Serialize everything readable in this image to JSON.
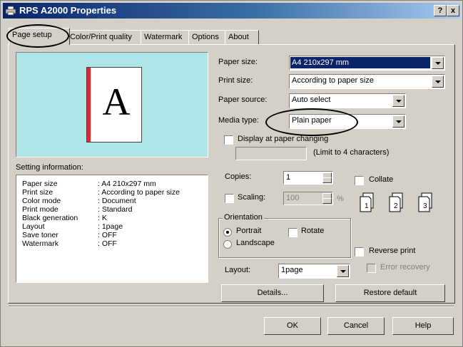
{
  "window": {
    "title": "RPS A2000 Properties",
    "help_button": "?",
    "close_button": "x"
  },
  "tabs": [
    {
      "label": "Page setup"
    },
    {
      "label": "Color/Print quality"
    },
    {
      "label": "Watermark"
    },
    {
      "label": "Options"
    },
    {
      "label": "About"
    }
  ],
  "preview": {
    "letter": "A"
  },
  "setting_info": {
    "title": "Setting information:",
    "rows": [
      {
        "key": "Paper size",
        "value": ": A4 210x297 mm"
      },
      {
        "key": "Print size",
        "value": ": According to paper size"
      },
      {
        "key": "Color mode",
        "value": ": Document"
      },
      {
        "key": "Print mode",
        "value": ": Standard"
      },
      {
        "key": "Black generation",
        "value": ": K"
      },
      {
        "key": "Layout",
        "value": ": 1page"
      },
      {
        "key": "Save toner",
        "value": ": OFF"
      },
      {
        "key": "Watermark",
        "value": ": OFF"
      }
    ]
  },
  "form": {
    "paper_size_label": "Paper size:",
    "paper_size_value": "A4 210x297 mm",
    "print_size_label": "Print size:",
    "print_size_value": "According to paper size",
    "paper_source_label": "Paper source:",
    "paper_source_value": "Auto select",
    "media_type_label": "Media type:",
    "media_type_value": "Plain paper",
    "display_label": "Display at paper changing",
    "limit_label": "(Limit to 4 characters)",
    "display_value": "",
    "copies_label": "Copies:",
    "copies_value": "1",
    "collate_label": "Collate",
    "scaling_label": "Scaling:",
    "scaling_value": "100",
    "scaling_unit": "%",
    "orientation_label": "Orientation",
    "portrait_label": "Portrait",
    "rotate_label": "Rotate",
    "landscape_label": "Landscape",
    "reverse_label": "Reverse print",
    "error_recovery_label": "Error recovery",
    "layout_label": "Layout:",
    "layout_value": "1page",
    "copy_icons": [
      "1",
      "2",
      "3"
    ]
  },
  "buttons": {
    "details": "Details...",
    "restore": "Restore default",
    "ok": "OK",
    "cancel": "Cancel",
    "help": "Help"
  }
}
